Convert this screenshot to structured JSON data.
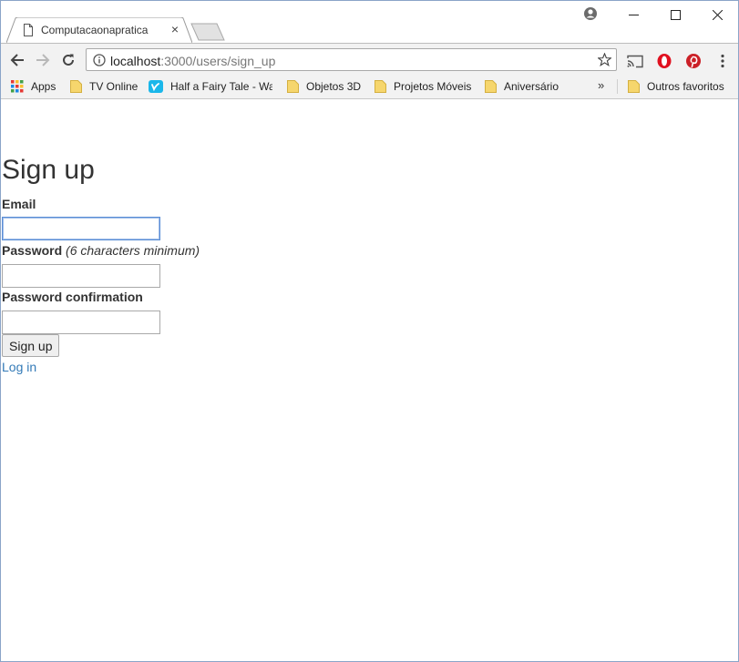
{
  "browser": {
    "tab": {
      "title": "Computacaonapratica",
      "close": "×"
    },
    "url": {
      "host": "localhost",
      "path": ":3000/users/sign_up"
    },
    "bookmarks": [
      {
        "label": "Apps",
        "icon": "apps-grid-icon"
      },
      {
        "label": "TV Online",
        "icon": "folder-icon"
      },
      {
        "label": "Half a Fairy Tale - Wat",
        "icon": "vimeo-icon"
      },
      {
        "label": "Objetos 3D",
        "icon": "folder-icon"
      },
      {
        "label": "Projetos Móveis",
        "icon": "folder-icon"
      },
      {
        "label": "Aniversário",
        "icon": "folder-icon"
      }
    ],
    "overflow": "»",
    "other_bookmarks": "Outros favoritos"
  },
  "page": {
    "title": "Sign up",
    "email_label": "Email",
    "password_label": "Password",
    "password_hint": "(6 characters minimum)",
    "password_confirmation_label": "Password confirmation",
    "email_value": "",
    "password_value": "",
    "password_confirmation_value": "",
    "submit_label": "Sign up",
    "login_link": "Log in"
  },
  "colors": {
    "link": "#337ab7",
    "focus": "#5b8ed6",
    "folder": "#f6d66d",
    "vimeo": "#1ab7ea",
    "opera": "#e0101f",
    "pinterest": "#cb2027"
  }
}
